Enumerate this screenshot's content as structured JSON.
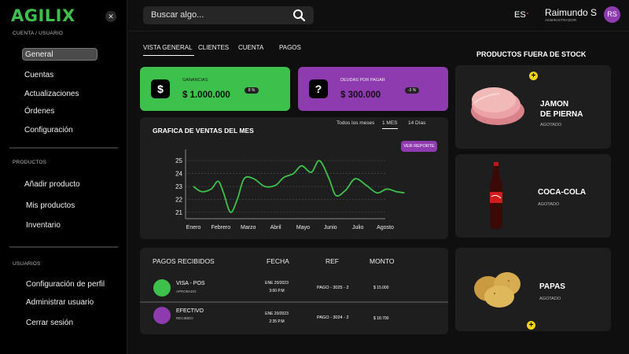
{
  "app": {
    "logo": "AGILIX",
    "close_icon": "close-icon"
  },
  "sidebar": {
    "sections": [
      {
        "label": "CUENTA / USUARIO",
        "items": [
          "General",
          "Cuentas",
          "Actualizaciones",
          "Órdenes",
          "Configuración"
        ]
      },
      {
        "label": "PRODUCTOS",
        "items": [
          "Añadir producto",
          "Mis productos",
          "Inventario"
        ]
      },
      {
        "label": "USUARIOS",
        "items": [
          "Configuración de perfil",
          "Administrar usuario",
          "Cerrar sesión"
        ]
      }
    ],
    "active_item": "General"
  },
  "header": {
    "search_placeholder": "Buscar algo...",
    "language": "ES",
    "user_name": "Raimundo S",
    "user_role": "ADMINISTRADOR",
    "avatar_initials": "RS"
  },
  "tabs": [
    "VISTA GENERAL",
    "CLIENTES",
    "CUENTA",
    "PAGOS"
  ],
  "active_tab": "VISTA GENERAL",
  "stats": [
    {
      "icon": "dollar-icon",
      "glyph": "$",
      "label": "GANANCIAS",
      "value": "$ 1.000.000",
      "badge": "8 %",
      "color": "#3dc14c"
    },
    {
      "icon": "question-icon",
      "glyph": "?",
      "label": "DEUDAS POR PAGAR",
      "value": "$ 300.000",
      "badge": "-3 %",
      "color": "#8e3bb0"
    }
  ],
  "chart": {
    "title": "GRAFICA DE VENTAS DEL MES",
    "ranges": [
      "Todos los meses",
      "1 MES",
      "14 Días"
    ],
    "active_range": "1 MES",
    "report_button": "VER REPORTE"
  },
  "chart_data": {
    "type": "line",
    "x": [
      "Enero",
      "Febrero",
      "Marzo",
      "Abril",
      "Mayo",
      "Junio",
      "Julio",
      "Agosto"
    ],
    "ylim": [
      20.5,
      25.5
    ],
    "yticks": [
      21,
      22,
      23,
      24,
      25
    ],
    "grid": true,
    "series": [
      {
        "color": "#3dc14c",
        "points": [
          [
            0.0,
            23.0
          ],
          [
            0.3,
            22.6
          ],
          [
            0.65,
            22.8
          ],
          [
            0.9,
            23.4
          ],
          [
            1.1,
            22.5
          ],
          [
            1.35,
            21.0
          ],
          [
            1.6,
            22.0
          ],
          [
            1.85,
            23.6
          ],
          [
            2.2,
            23.6
          ],
          [
            2.6,
            23.0
          ],
          [
            3.0,
            23.1
          ],
          [
            3.3,
            23.7
          ],
          [
            3.65,
            24.0
          ],
          [
            3.95,
            24.6
          ],
          [
            4.3,
            24.1
          ],
          [
            4.6,
            25.0
          ],
          [
            4.95,
            23.6
          ],
          [
            5.2,
            22.3
          ],
          [
            5.55,
            22.7
          ],
          [
            5.9,
            23.6
          ],
          [
            6.3,
            23.1
          ],
          [
            6.7,
            22.5
          ],
          [
            7.05,
            22.8
          ],
          [
            7.4,
            22.6
          ],
          [
            7.7,
            22.5
          ]
        ]
      }
    ]
  },
  "payments": {
    "headers": [
      "PAGOS RECIBIDOS",
      "FECHA",
      "REF",
      "MONTO"
    ],
    "rows": [
      {
        "method": "VISA - POS",
        "status": "APROBADO",
        "date": "ENE 20/2023",
        "time": "3:00 P.M",
        "ref": "PAGO - 3025 - 2",
        "amount": "$ 15.000",
        "color": "#3dc14c"
      },
      {
        "method": "EFECTIVO",
        "status": "RECIBIDO",
        "date": "ENE 20/2023",
        "time": "2:35 P.M",
        "ref": "PAGO - 3024 - 2",
        "amount": "$ 18.700",
        "color": "#8e3bb0"
      }
    ]
  },
  "out_of_stock": {
    "title": "PRODUCTOS FUERA DE STOCK",
    "items": [
      {
        "name_line1": "JAMON",
        "name_line2": "DE PIERNA",
        "status": "AGOTADO",
        "image": "ham-image"
      },
      {
        "name_line1": "COCA-COLA",
        "name_line2": "",
        "status": "AGOTADO",
        "image": "coca-cola-bottle-image"
      },
      {
        "name_line1": "PAPAS",
        "name_line2": "",
        "status": "AGOTADO",
        "image": "potatoes-image"
      }
    ]
  },
  "colors": {
    "green": "#3dc14c",
    "purple": "#8e3bb0",
    "badge_yellow": "#f2d21b"
  }
}
